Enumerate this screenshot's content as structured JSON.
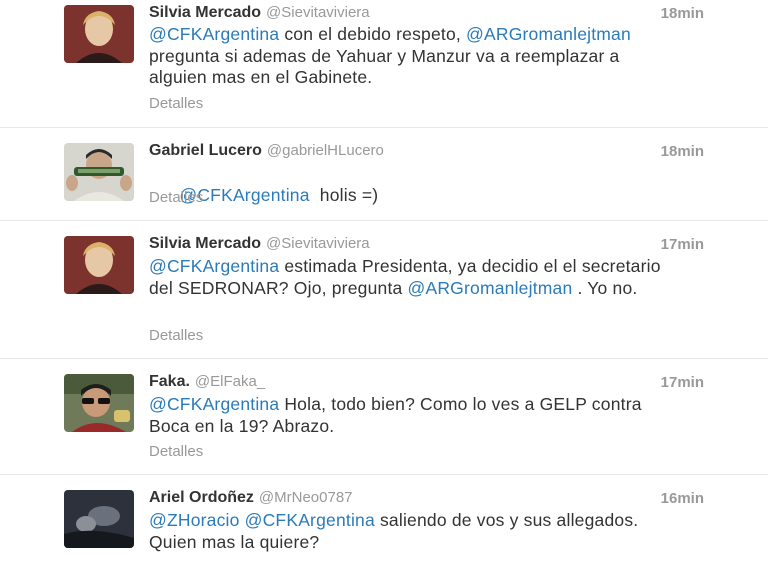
{
  "tweets": [
    {
      "avatar": "woman-portrait-avatar",
      "name": "Silvia Mercado",
      "handle": "@Sievitaviviera",
      "time": "18min",
      "segments": [
        {
          "text": "@CFKArgentina",
          "mention": true
        },
        {
          "text": " con el debido respeto, ",
          "mention": false
        },
        {
          "text": "@ARGromanlejtman",
          "mention": true
        },
        {
          "text": " pregunta si ademas de Yahuar y Manzur va a reemplazar a alguien mas en el Gabinete.",
          "mention": false
        }
      ],
      "details": "Detalles"
    },
    {
      "avatar": "man-with-object-avatar",
      "name": "Gabriel Lucero",
      "handle": "@gabrielHLucero",
      "time": "18min",
      "segments": [
        {
          "text": "@CFKArgentina",
          "mention": true
        },
        {
          "text": "  holis =)",
          "mention": false
        }
      ],
      "details": "Detalles"
    },
    {
      "avatar": "woman-portrait-avatar",
      "name": "Silvia Mercado",
      "handle": "@Sievitaviviera",
      "time": "17min",
      "segments": [
        {
          "text": "@CFKArgentina",
          "mention": true
        },
        {
          "text": " estimada Presidenta, ya decidio el el secretario del SEDRONAR? Ojo, pregunta ",
          "mention": false
        },
        {
          "text": "@ARGromanlejtman",
          "mention": true
        },
        {
          "text": " . Yo no.",
          "mention": false
        }
      ],
      "details": "Detalles"
    },
    {
      "avatar": "man-sunglasses-avatar",
      "name": "Faka.",
      "handle": "@ElFaka_",
      "time": "17min",
      "segments": [
        {
          "text": "@CFKArgentina",
          "mention": true
        },
        {
          "text": " Hola, todo bien? Como lo ves a GELP contra Boca en la 19? Abrazo.",
          "mention": false
        }
      ],
      "details": "Detalles"
    },
    {
      "avatar": "dark-photo-avatar",
      "name": "Ariel Ordoñez",
      "handle": "@MrNeo0787",
      "time": "16min",
      "segments": [
        {
          "text": "@ZHoracio",
          "mention": true
        },
        {
          "text": " ",
          "mention": false
        },
        {
          "text": "@CFKArgentina",
          "mention": true
        },
        {
          "text": " saliendo de vos y sus allegados. Quien mas la quiere?",
          "mention": false
        }
      ],
      "details": ""
    }
  ]
}
